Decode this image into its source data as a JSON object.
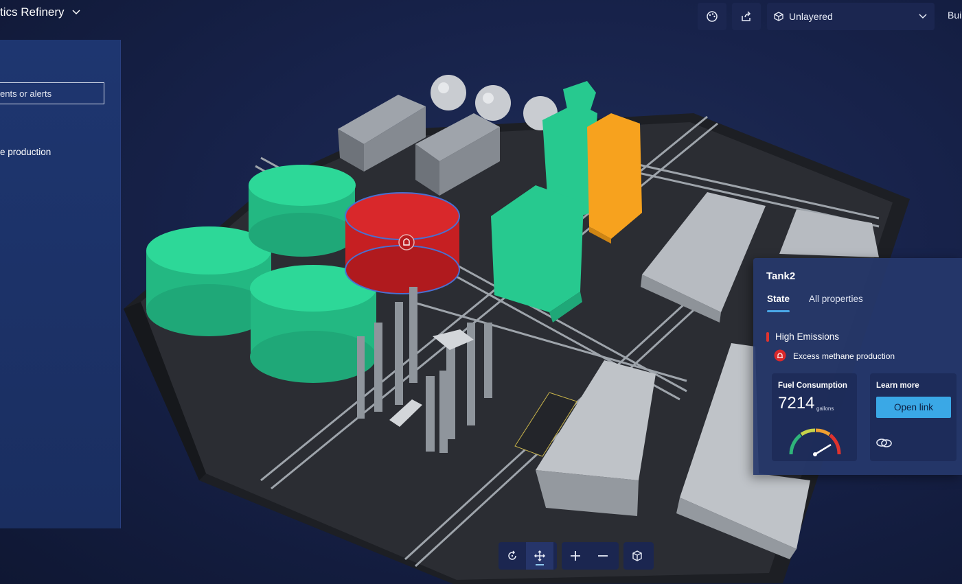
{
  "header": {
    "title": "tics Refinery",
    "layer_selector": {
      "value": "Unlayered"
    },
    "build_label": "Bui",
    "icons": [
      "chevron-down-icon",
      "palette-icon",
      "share-icon",
      "cube-icon",
      "chevron-down-icon"
    ]
  },
  "left_panel": {
    "search_placeholder": "ents or alerts",
    "alert_item": "e production"
  },
  "card": {
    "title": "Tank2",
    "tabs": [
      {
        "label": "State",
        "active": true
      },
      {
        "label": "All properties",
        "active": false
      }
    ],
    "status": {
      "title": "High Emissions",
      "alert": "Excess methane production",
      "color": "#e0332e"
    },
    "metric": {
      "label": "Fuel Consumption",
      "value": "7214",
      "unit": "gallons"
    },
    "link": {
      "label": "Learn more",
      "button": "Open link"
    }
  },
  "toolbar": {
    "buttons": [
      {
        "name": "rotate-icon",
        "active": false
      },
      {
        "name": "pan-icon",
        "active": true
      },
      {
        "name": "zoom-in-icon",
        "active": false
      },
      {
        "name": "zoom-out-icon",
        "active": false
      },
      {
        "name": "3d-view-icon",
        "active": false
      }
    ]
  },
  "scene": {
    "colors": {
      "normal": "#27c98f",
      "alert": "#d9282b",
      "warning": "#f7a21e",
      "ground": "#2b2d33",
      "structure": "#a8adb4"
    }
  }
}
